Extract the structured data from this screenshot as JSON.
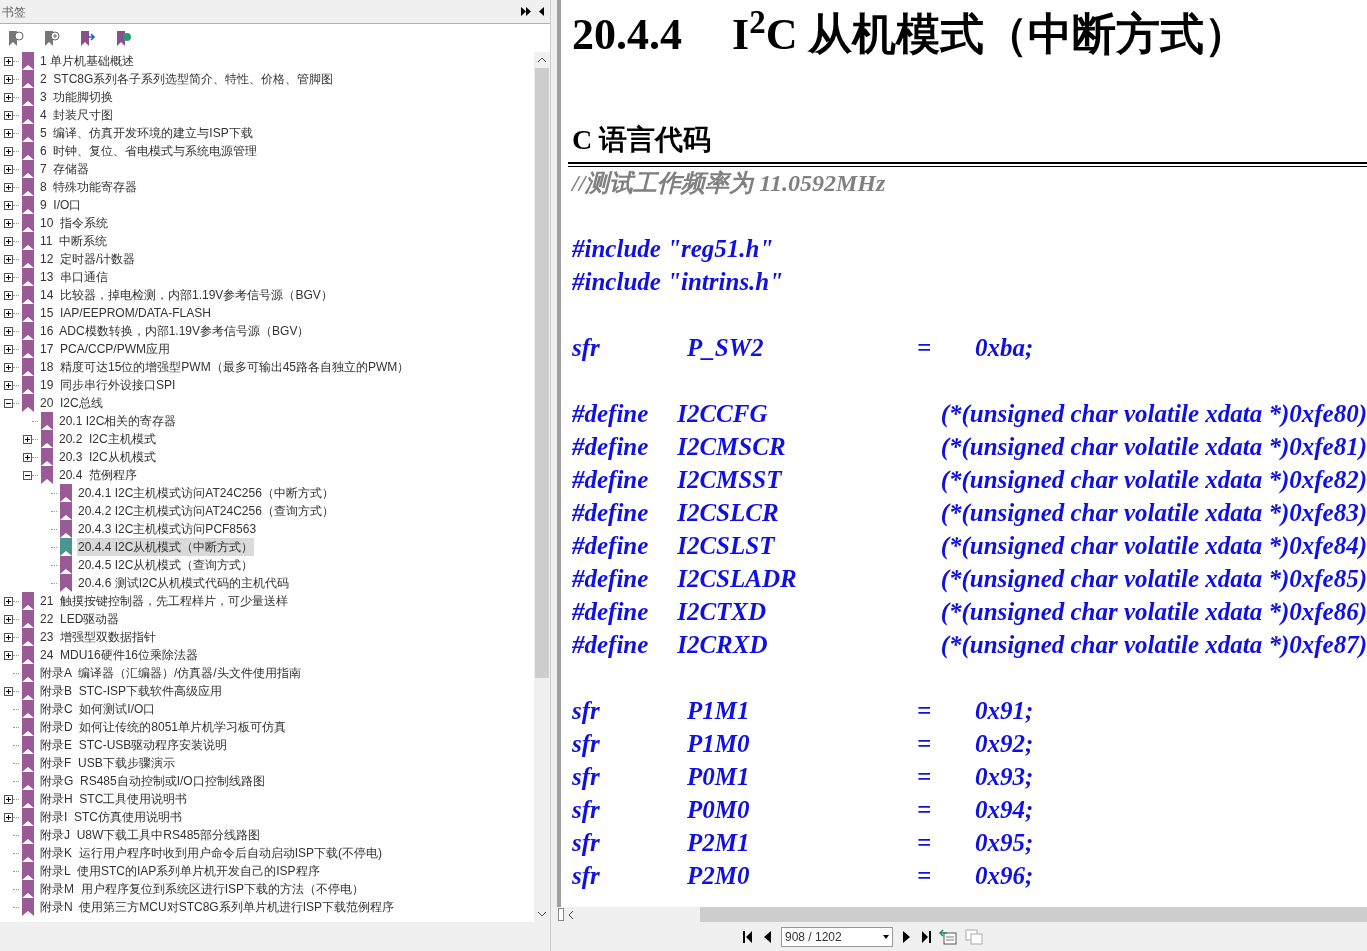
{
  "sidebar": {
    "title": "书签",
    "tree": [
      {
        "label": "1 单片机基础概述",
        "expanded": false,
        "selected": false
      },
      {
        "label": "2  STC8G系列各子系列选型简介、特性、价格、管脚图",
        "expanded": false,
        "selected": false
      },
      {
        "label": "3  功能脚切换",
        "expanded": false,
        "selected": false
      },
      {
        "label": "4  封装尺寸图",
        "expanded": false,
        "selected": false
      },
      {
        "label": "5  编译、仿真开发环境的建立与ISP下载",
        "expanded": false,
        "selected": false
      },
      {
        "label": "6  时钟、复位、省电模式与系统电源管理",
        "expanded": false,
        "selected": false
      },
      {
        "label": "7  存储器",
        "expanded": false,
        "selected": false
      },
      {
        "label": "8  特殊功能寄存器",
        "expanded": false,
        "selected": false
      },
      {
        "label": "9  I/O口",
        "expanded": false,
        "selected": false
      },
      {
        "label": "10  指令系统",
        "expanded": false,
        "selected": false
      },
      {
        "label": "11  中断系统",
        "expanded": false,
        "selected": false
      },
      {
        "label": "12  定时器/计数器",
        "expanded": false,
        "selected": false
      },
      {
        "label": "13  串口通信",
        "expanded": false,
        "selected": false
      },
      {
        "label": "14  比较器，掉电检测，内部1.19V参考信号源（BGV）",
        "expanded": false,
        "selected": false
      },
      {
        "label": "15  IAP/EEPROM/DATA-FLASH",
        "expanded": false,
        "selected": false
      },
      {
        "label": "16  ADC模数转换，内部1.19V参考信号源（BGV）",
        "expanded": false,
        "selected": false
      },
      {
        "label": "17  PCA/CCP/PWM应用",
        "expanded": false,
        "selected": false
      },
      {
        "label": "18  精度可达15位的增强型PWM（最多可输出45路各自独立的PWM）",
        "expanded": false,
        "selected": false
      },
      {
        "label": "19  同步串行外设接口SPI",
        "expanded": false,
        "selected": false
      },
      {
        "label": "20  I2C总线",
        "expanded": true,
        "selected": false,
        "children": [
          {
            "label": "20.1 I2C相关的寄存器",
            "selected": false
          },
          {
            "label": "20.2  I2C主机模式",
            "expanded": false,
            "selected": false
          },
          {
            "label": "20.3  I2C从机模式",
            "expanded": false,
            "selected": false
          },
          {
            "label": "20.4  范例程序",
            "expanded": true,
            "selected": false,
            "children": [
              {
                "label": "20.4.1 I2C主机模式访问AT24C256（中断方式）",
                "selected": false
              },
              {
                "label": "20.4.2 I2C主机模式访问AT24C256（查询方式）",
                "selected": false
              },
              {
                "label": "20.4.3 I2C主机模式访问PCF8563",
                "selected": false
              },
              {
                "label": "20.4.4 I2C从机模式（中断方式）",
                "selected": true
              },
              {
                "label": "20.4.5 I2C从机模式（查询方式）",
                "selected": false
              },
              {
                "label": "20.4.6 测试I2C从机模式代码的主机代码",
                "selected": false
              }
            ]
          }
        ]
      },
      {
        "label": "21  触摸按键控制器，先工程样片，可少量送样",
        "expanded": false,
        "selected": false
      },
      {
        "label": "22  LED驱动器",
        "expanded": false,
        "selected": false
      },
      {
        "label": "23  增强型双数据指针",
        "expanded": false,
        "selected": false
      },
      {
        "label": "24  MDU16硬件16位乘除法器",
        "expanded": false,
        "selected": false
      },
      {
        "label": "附录A  编译器（汇编器）/仿真器/头文件使用指南",
        "selected": false
      },
      {
        "label": "附录B  STC-ISP下载软件高级应用",
        "expanded": false,
        "selected": false
      },
      {
        "label": "附录C  如何测试I/O口",
        "selected": false
      },
      {
        "label": "附录D  如何让传统的8051单片机学习板可仿真",
        "selected": false
      },
      {
        "label": "附录E  STC-USB驱动程序安装说明",
        "selected": false
      },
      {
        "label": "附录F  USB下载步骤演示",
        "selected": false
      },
      {
        "label": "附录G  RS485自动控制或I/O口控制线路图",
        "selected": false
      },
      {
        "label": "附录H  STC工具使用说明书",
        "expanded": false,
        "selected": false
      },
      {
        "label": "附录I  STC仿真使用说明书",
        "expanded": false,
        "selected": false
      },
      {
        "label": "附录J  U8W下载工具中RS485部分线路图",
        "selected": false
      },
      {
        "label": "附录K  运行用户程序时收到用户命令后自动启动ISP下载(不停电)",
        "selected": false
      },
      {
        "label": "附录L  使用STC的IAP系列单片机开发自己的ISP程序",
        "selected": false
      },
      {
        "label": "附录M  用户程序复位到系统区进行ISP下载的方法（不停电）",
        "selected": false
      },
      {
        "label": "附录N  使用第三方MCU对STC8G系列单片机进行ISP下载范例程序",
        "selected": false
      }
    ]
  },
  "document": {
    "section_number": "20.4.4",
    "section_title": "I$^{2}$C 从机模式（中断方式）",
    "subheading": "C 语言代码",
    "comment": "//测试工作频率为 11.0592MHz",
    "lines": [
      {
        "kind": "blank"
      },
      {
        "kind": "include",
        "text": "#include \"reg51.h\""
      },
      {
        "kind": "include",
        "text": "#include \"intrins.h\""
      },
      {
        "kind": "blank"
      },
      {
        "kind": "decl",
        "keyword": "sfr",
        "name": "P_SW2",
        "op": "=",
        "value": "0xba;"
      },
      {
        "kind": "blank"
      },
      {
        "kind": "decl",
        "keyword": "#define",
        "name": "I2CCFG",
        "value": "(*(unsigned char volatile xdata *)0xfe80)"
      },
      {
        "kind": "decl",
        "keyword": "#define",
        "name": "I2CMSCR",
        "value": "(*(unsigned char volatile xdata *)0xfe81)"
      },
      {
        "kind": "decl",
        "keyword": "#define",
        "name": "I2CMSST",
        "value": "(*(unsigned char volatile xdata *)0xfe82)"
      },
      {
        "kind": "decl",
        "keyword": "#define",
        "name": "I2CSLCR",
        "value": "(*(unsigned char volatile xdata *)0xfe83)"
      },
      {
        "kind": "decl",
        "keyword": "#define",
        "name": "I2CSLST",
        "value": "(*(unsigned char volatile xdata *)0xfe84)"
      },
      {
        "kind": "decl",
        "keyword": "#define",
        "name": "I2CSLADR",
        "value": "(*(unsigned char volatile xdata *)0xfe85)"
      },
      {
        "kind": "decl",
        "keyword": "#define",
        "name": "I2CTXD",
        "value": "(*(unsigned char volatile xdata *)0xfe86)"
      },
      {
        "kind": "decl",
        "keyword": "#define",
        "name": "I2CRXD",
        "value": "(*(unsigned char volatile xdata *)0xfe87)"
      },
      {
        "kind": "blank"
      },
      {
        "kind": "decl",
        "keyword": "sfr",
        "name": "P1M1",
        "op": "=",
        "value": "0x91;"
      },
      {
        "kind": "decl",
        "keyword": "sfr",
        "name": "P1M0",
        "op": "=",
        "value": "0x92;"
      },
      {
        "kind": "decl",
        "keyword": "sfr",
        "name": "P0M1",
        "op": "=",
        "value": "0x93;"
      },
      {
        "kind": "decl",
        "keyword": "sfr",
        "name": "P0M0",
        "op": "=",
        "value": "0x94;"
      },
      {
        "kind": "decl",
        "keyword": "sfr",
        "name": "P2M1",
        "op": "=",
        "value": "0x95;"
      },
      {
        "kind": "decl",
        "keyword": "sfr",
        "name": "P2M0",
        "op": "=",
        "value": "0x96;"
      }
    ]
  },
  "navigation": {
    "page_field": "908 / 1202"
  }
}
